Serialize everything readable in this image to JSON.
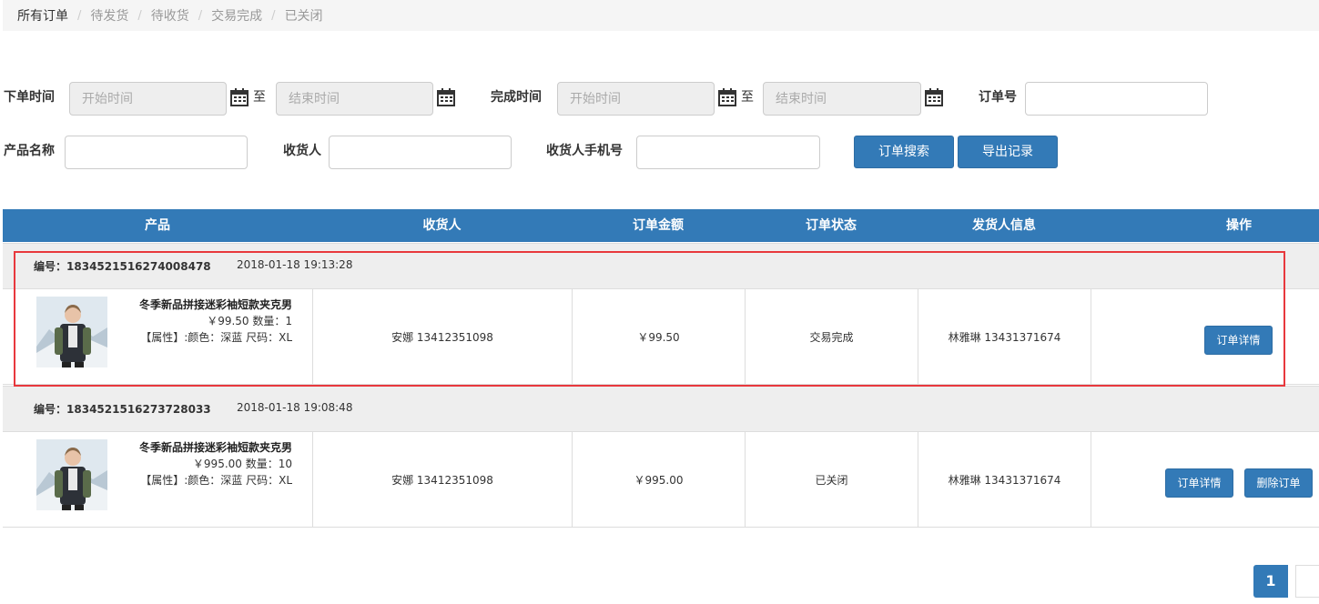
{
  "tabs": [
    "所有订单",
    "待发货",
    "待收货",
    "交易完成",
    "已关闭"
  ],
  "filters": {
    "order_time_label": "下单时间",
    "complete_time_label": "完成时间",
    "start_placeholder": "开始时间",
    "end_placeholder": "结束时间",
    "to_label": "至",
    "order_no_label": "订单号",
    "product_name_label": "产品名称",
    "receiver_label": "收货人",
    "receiver_phone_label": "收货人手机号",
    "search_button": "订单搜索",
    "export_button": "导出记录"
  },
  "table": {
    "headers": [
      "产品",
      "收货人",
      "订单金额",
      "订单状态",
      "发货人信息",
      "操作"
    ]
  },
  "orders": [
    {
      "no_label": "编号：",
      "no": "1834521516274008478",
      "date": "2018-01-18 19:13:28",
      "product_name": "冬季新品拼接迷彩袖短款夹克男",
      "price_qty": "￥99.50 数量：1",
      "attrs": "【属性】:颜色：深蓝 尺码：XL",
      "receiver": "安娜 13412351098",
      "amount": "￥99.50",
      "status": "交易完成",
      "sender": "林雅琳 13431371674",
      "actions": [
        "订单详情"
      ]
    },
    {
      "no_label": "编号：",
      "no": "1834521516273728033",
      "date": "2018-01-18 19:08:48",
      "product_name": "冬季新品拼接迷彩袖短款夹克男",
      "price_qty": "￥995.00 数量：10",
      "attrs": "【属性】:颜色：深蓝 尺码：XL",
      "receiver": "安娜 13412351098",
      "amount": "￥995.00",
      "status": "已关闭",
      "sender": "林雅琳 13431371674",
      "actions": [
        "订单详情",
        "删除订单"
      ]
    }
  ],
  "pagination": {
    "current": "1"
  },
  "colors": {
    "primary": "#337ab7",
    "highlight": "#e8383d"
  },
  "icons": {
    "calendar": "calendar-icon"
  }
}
